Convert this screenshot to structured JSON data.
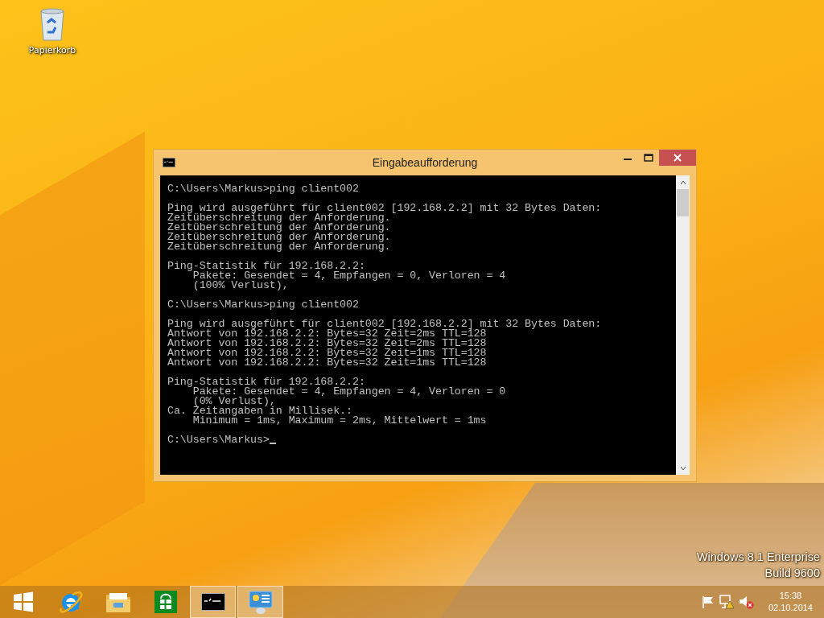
{
  "desktop_icons": [
    {
      "kind": "recycle-bin",
      "label": "Papierkorb"
    }
  ],
  "window": {
    "title": "Eingabeaufforderung",
    "cursor": true,
    "blocks": [
      [
        "C:\\Users\\Markus>ping client002"
      ],
      [
        "Ping wird ausgeführt für client002 [192.168.2.2] mit 32 Bytes Daten:",
        "Zeitüberschreitung der Anforderung.",
        "Zeitüberschreitung der Anforderung.",
        "Zeitüberschreitung der Anforderung.",
        "Zeitüberschreitung der Anforderung."
      ],
      [
        "Ping-Statistik für 192.168.2.2:",
        "    Pakete: Gesendet = 4, Empfangen = 0, Verloren = 4",
        "    (100% Verlust),"
      ],
      [
        "C:\\Users\\Markus>ping client002"
      ],
      [
        "Ping wird ausgeführt für client002 [192.168.2.2] mit 32 Bytes Daten:",
        "Antwort von 192.168.2.2: Bytes=32 Zeit=2ms TTL=128",
        "Antwort von 192.168.2.2: Bytes=32 Zeit=2ms TTL=128",
        "Antwort von 192.168.2.2: Bytes=32 Zeit=1ms TTL=128",
        "Antwort von 192.168.2.2: Bytes=32 Zeit=1ms TTL=128"
      ],
      [
        "Ping-Statistik für 192.168.2.2:",
        "    Pakete: Gesendet = 4, Empfangen = 4, Verloren = 0",
        "    (0% Verlust),",
        "Ca. Zeitangaben in Millisek.:",
        "    Minimum = 1ms, Maximum = 2ms, Mittelwert = 1ms"
      ],
      [
        "C:\\Users\\Markus>"
      ]
    ]
  },
  "edition": [
    "Windows 8.1 Enterprise",
    "Build 9600"
  ],
  "taskbar": {
    "items": [
      {
        "kind": "start",
        "running": false
      },
      {
        "kind": "browser",
        "running": false
      },
      {
        "kind": "folder",
        "running": false
      },
      {
        "kind": "store",
        "running": false
      },
      {
        "kind": "console",
        "running": true
      },
      {
        "kind": "control-panel",
        "running": true
      }
    ],
    "tray": [
      {
        "kind": "flag"
      },
      {
        "kind": "network-warning"
      },
      {
        "kind": "speaker-muted"
      }
    ],
    "time": "15:38",
    "date": "02.10.2014"
  }
}
